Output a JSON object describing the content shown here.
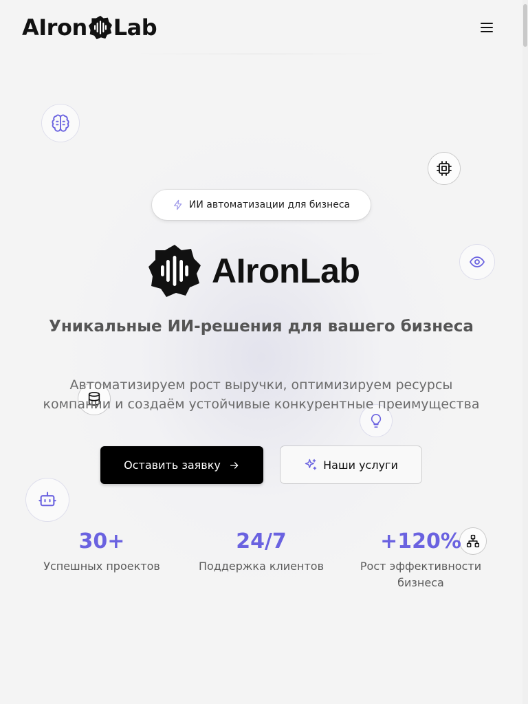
{
  "header": {
    "logo_left": "AIron",
    "logo_right": "Lab",
    "menu_icon": "hamburger-icon"
  },
  "hero": {
    "badge_text": "ИИ автоматизации для бизнеса",
    "badge_icon": "lightning-icon",
    "brand_name": "AIronLab",
    "headline": "Уникальные ИИ-решения для вашего бизнеса",
    "lead_line1": "Автоматизируем рост выручки, оптимизируем ресурсы",
    "lead_line2": "компании и создаём устойчивые конкурентные преимущества",
    "primary_button": "Оставить заявку",
    "secondary_button": "Наши услуги"
  },
  "stats": [
    {
      "value": "30+",
      "label": "Успешных проектов"
    },
    {
      "value": "24/7",
      "label": "Поддержка клиентов"
    },
    {
      "value": "+120%",
      "label_line1": "Рост эффективности",
      "label_line2": "бизнеса"
    }
  ],
  "floating_icons": [
    "brain-icon",
    "cpu-icon",
    "eye-icon",
    "database-icon",
    "lightbulb-icon",
    "bot-icon",
    "network-icon"
  ],
  "colors": {
    "accent": "#6a62e0",
    "primary_button_bg": "#000000",
    "background": "#f4f4f4"
  }
}
